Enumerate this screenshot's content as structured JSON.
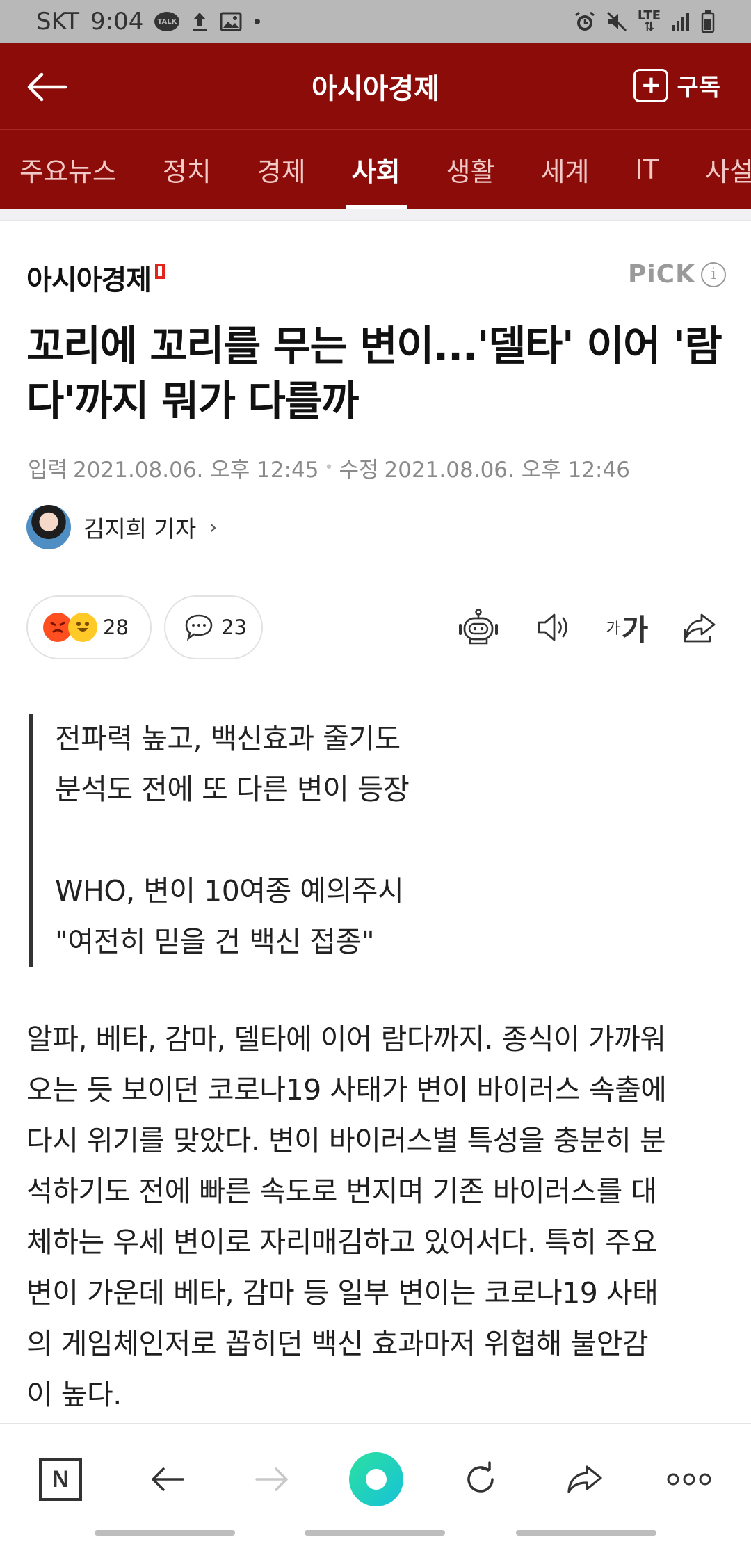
{
  "status_bar": {
    "carrier": "SKT",
    "time": "9:04",
    "talk_icon_text": "TALK",
    "network": "LTE",
    "icons_left": [
      "talk-icon",
      "upload-icon",
      "image-icon",
      "dot-icon"
    ],
    "icons_right": [
      "alarm-icon",
      "mute-icon",
      "lte-icon",
      "signal-icon",
      "battery-icon"
    ]
  },
  "header": {
    "title": "아시아경제",
    "subscribe_label": "구독",
    "subscribe_plus": "+"
  },
  "tabs": [
    {
      "label": "주요뉴스",
      "active": false
    },
    {
      "label": "정치",
      "active": false
    },
    {
      "label": "경제",
      "active": false
    },
    {
      "label": "사회",
      "active": true
    },
    {
      "label": "생활",
      "active": false
    },
    {
      "label": "세계",
      "active": false
    },
    {
      "label": "IT",
      "active": false
    },
    {
      "label": "사설",
      "active": false
    }
  ],
  "publisher": {
    "name": "아시아경제",
    "pick_label": "PiCK",
    "info_symbol": "i"
  },
  "article": {
    "title": "꼬리에 꼬리를 무는 변이...'델타' 이어 '람다'까지 뭐가 다를까",
    "input_label": "입력",
    "input_date": "2021.08.06. 오후 12:45",
    "edit_label": "수정",
    "edit_date": "2021.08.06. 오후 12:46",
    "reporter": "김지희 기자",
    "reporter_chevron": "›",
    "reaction_count": "28",
    "comment_count": "23",
    "font_small": "가",
    "font_large": "가",
    "summary": [
      "전파력 높고, 백신효과 줄기도",
      "분석도 전에 또 다른 변이 등장",
      "",
      "WHO, 변이 10여종 예의주시",
      "\"여전히 믿을 건 백신 접종\""
    ],
    "body_lines": [
      "알파, 베타, 감마, 델타에 이어 람다까지. 종식이 가까워",
      "오는 듯 보이던 코로나19 사태가 변이 바이러스 속출에",
      "다시 위기를 맞았다. 변이 바이러스별 특성을 충분히 분",
      "석하기도 전에 빠른 속도로 번지며 기존 바이러스를 대",
      "체하는 우세 변이로 자리매김하고 있어서다. 특히 주요",
      "변이 가운데 베타, 감마 등 일부 변이는 코로나19 사태",
      "의 게임체인저로 꼽히던 백신 효과마저 위협해 불안감",
      "이 높다."
    ]
  },
  "browser_bar": {
    "n_label": "N",
    "items": [
      "naver-home-icon",
      "back-arrow-icon",
      "forward-arrow-icon",
      "green-dot-icon",
      "refresh-icon",
      "share-icon",
      "more-icon"
    ]
  },
  "colors": {
    "brand": "#8b0c08",
    "tab_inactive": "#f1c9c7",
    "logo_accent": "#e1251b",
    "orb_start": "#2ce0a0",
    "orb_end": "#16c2d8"
  }
}
